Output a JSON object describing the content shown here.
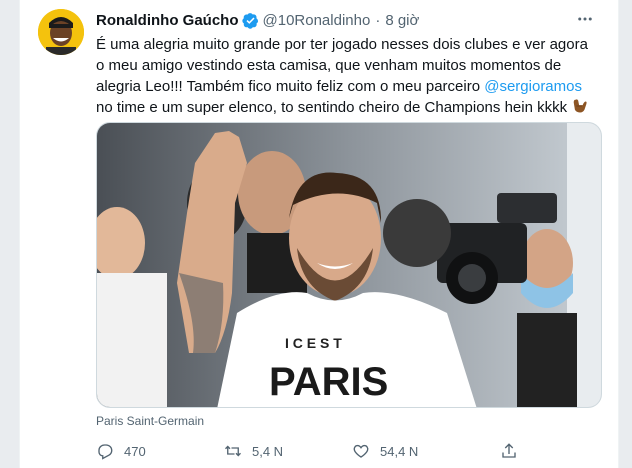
{
  "tweet": {
    "author_name": "Ronaldinho Gaúcho",
    "handle": "@10Ronaldinho",
    "separator": "·",
    "time": "8 giờ",
    "text_part1": "É uma alegria muito grande por ter jogado nesses dois clubes e ver agora o meu amigo vestindo esta camisa, que venham muitos momentos de alegria Leo!!! Também fico muito feliz com o meu parceiro ",
    "mention": "@sergioramos",
    "text_part2": " no time e um super elenco, to sentindo cheiro de Champions hein kkkk",
    "photo_shirt_text_line1": "I C E S T",
    "photo_shirt_text_line2": "PARIS",
    "media_caption": "Paris Saint-Germain"
  },
  "actions": {
    "reply_count": "470",
    "retweet_count": "5,4 N",
    "like_count": "54,4 N"
  },
  "icons": {
    "verified": "verified-badge-icon",
    "more": "more-icon",
    "reply": "reply-icon",
    "retweet": "retweet-icon",
    "like": "heart-icon",
    "share": "share-icon",
    "emoji": "call-me-hand-emoji"
  },
  "colors": {
    "accent": "#1d9bf0",
    "text": "#0f1419",
    "muted": "#536471"
  }
}
